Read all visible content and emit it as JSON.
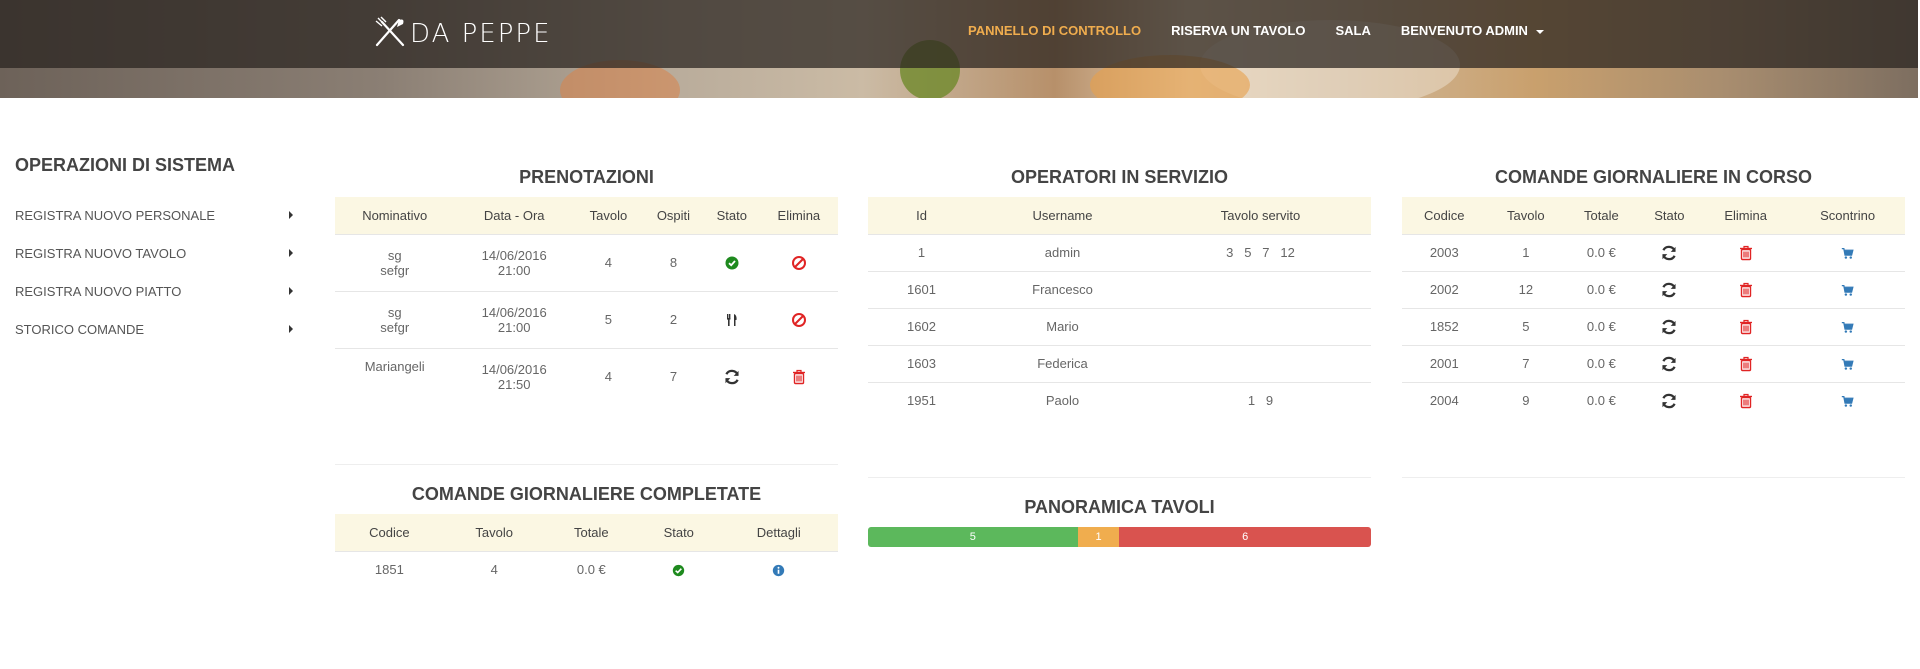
{
  "brand": {
    "name": "DA PEPPE",
    "logo_icon": "fork-knife-icon"
  },
  "nav": {
    "items": [
      {
        "label": "PANNELLO DI CONTROLLO",
        "active": true
      },
      {
        "label": "RISERVA UN TAVOLO",
        "active": false
      },
      {
        "label": "SALA",
        "active": false
      },
      {
        "label": "BENVENUTO ADMIN",
        "active": false,
        "dropdown": true
      }
    ]
  },
  "sidebar": {
    "title": "OPERAZIONI DI SISTEMA",
    "items": [
      {
        "label": "REGISTRA NUOVO PERSONALE"
      },
      {
        "label": "REGISTRA NUOVO TAVOLO"
      },
      {
        "label": "REGISTRA NUOVO PIATTO"
      },
      {
        "label": "STORICO COMANDE"
      }
    ]
  },
  "prenotazioni": {
    "title": "PRENOTAZIONI",
    "headers": [
      "Nominativo",
      "Data - Ora",
      "Tavolo",
      "Ospiti",
      "Stato",
      "Elimina"
    ],
    "rows": [
      {
        "nome1": "sg",
        "nome2": "sefgr",
        "data": "14/06/2016",
        "ora": "21:00",
        "tavolo": "4",
        "ospiti": "8",
        "stato": "check-circle-icon",
        "elimina": "ban-icon"
      },
      {
        "nome1": "sg",
        "nome2": "sefgr",
        "data": "14/06/2016",
        "ora": "21:00",
        "tavolo": "5",
        "ospiti": "2",
        "stato": "cutlery-icon",
        "elimina": "ban-icon"
      },
      {
        "nome1": "Mariangeli",
        "nome2": "",
        "data": "14/06/2016",
        "ora": "21:50",
        "tavolo": "4",
        "ospiti": "7",
        "stato": "refresh-icon",
        "elimina": "trash-icon"
      }
    ]
  },
  "operatori": {
    "title": "OPERATORI IN SERVIZIO",
    "headers": [
      "Id",
      "Username",
      "Tavolo servito"
    ],
    "rows": [
      {
        "id": "1",
        "username": "admin",
        "tavoli": "3   5   7   12"
      },
      {
        "id": "1601",
        "username": "Francesco",
        "tavoli": ""
      },
      {
        "id": "1602",
        "username": "Mario",
        "tavoli": ""
      },
      {
        "id": "1603",
        "username": "Federica",
        "tavoli": ""
      },
      {
        "id": "1951",
        "username": "Paolo",
        "tavoli": "1   9"
      }
    ]
  },
  "comande_corso": {
    "title": "COMANDE GIORNALIERE IN CORSO",
    "headers": [
      "Codice",
      "Tavolo",
      "Totale",
      "Stato",
      "Elimina",
      "Scontrino"
    ],
    "rows": [
      {
        "codice": "2003",
        "tavolo": "1",
        "totale": "0.0 €"
      },
      {
        "codice": "2002",
        "tavolo": "12",
        "totale": "0.0 €"
      },
      {
        "codice": "1852",
        "tavolo": "5",
        "totale": "0.0 €"
      },
      {
        "codice": "2001",
        "tavolo": "7",
        "totale": "0.0 €"
      },
      {
        "codice": "2004",
        "tavolo": "9",
        "totale": "0.0 €"
      }
    ]
  },
  "comande_completate": {
    "title": "COMANDE GIORNALIERE COMPLETATE",
    "headers": [
      "Codice",
      "Tavolo",
      "Totale",
      "Stato",
      "Dettagli"
    ],
    "rows": [
      {
        "codice": "1851",
        "tavolo": "4",
        "totale": "0.0 €"
      }
    ]
  },
  "panoramica": {
    "title": "PANORAMICA TAVOLI",
    "segments": [
      {
        "value": "5",
        "color": "#5cb85c",
        "fraction": 0.4167
      },
      {
        "value": "1",
        "color": "#f0ad4e",
        "fraction": 0.0833
      },
      {
        "value": "6",
        "color": "#d9534f",
        "fraction": 0.5
      }
    ]
  }
}
